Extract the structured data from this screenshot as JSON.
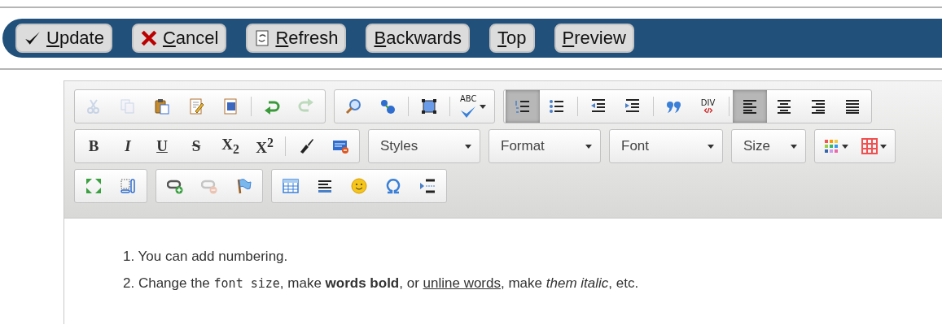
{
  "action_bar": {
    "buttons": [
      {
        "label": "Update"
      },
      {
        "label": "Cancel"
      },
      {
        "label": "Refresh"
      },
      {
        "label": "Backwards"
      },
      {
        "label": "Top"
      },
      {
        "label": "Preview"
      }
    ]
  },
  "editor": {
    "toolbar_rows": [
      {
        "items": [
          {
            "kind": "group",
            "sections": [
              [
                {
                  "disabled": true,
                  "on": false
                },
                {
                  "disabled": true,
                  "on": false
                },
                {
                  "disabled": false,
                  "on": false
                },
                {
                  "disabled": false,
                  "on": false
                },
                {
                  "disabled": false,
                  "on": false
                }
              ],
              [
                {
                  "disabled": false,
                  "on": false
                },
                {
                  "disabled": true,
                  "on": false
                }
              ]
            ]
          },
          {
            "kind": "group",
            "sections": [
              [
                {
                  "disabled": false,
                  "on": false
                },
                {
                  "disabled": false,
                  "on": false
                }
              ],
              [
                {
                  "disabled": false,
                  "on": false
                }
              ],
              [
                {
                  "disabled": false,
                  "glyph": "ABC",
                  "dropdown": true
                }
              ]
            ]
          },
          {
            "kind": "group",
            "sections": [
              [
                {
                  "disabled": false,
                  "on": true
                },
                {
                  "disabled": false,
                  "on": false
                }
              ],
              [
                {
                  "disabled": false,
                  "on": false
                },
                {
                  "disabled": false,
                  "on": false
                }
              ],
              [
                {
                  "disabled": false,
                  "on": false
                },
                {
                  "disabled": false,
                  "on": false,
                  "glyph": "DIV"
                }
              ],
              [
                {
                  "disabled": false,
                  "on": true
                },
                {
                  "disabled": false,
                  "on": false
                },
                {
                  "disabled": false,
                  "on": false
                },
                {
                  "disabled": false,
                  "on": false
                }
              ]
            ]
          }
        ]
      },
      {
        "items": [
          {
            "kind": "group",
            "sections": [
              [
                {
                  "disabled": false,
                  "on": false,
                  "glyph": "B"
                },
                {
                  "disabled": false,
                  "on": false,
                  "glyph": "I"
                },
                {
                  "disabled": false,
                  "on": false,
                  "glyph": "U"
                },
                {
                  "disabled": false,
                  "on": false,
                  "glyph": "S"
                },
                {
                  "disabled": false,
                  "on": false,
                  "glyph": "X$_{2}$"
                },
                {
                  "disabled": false,
                  "on": false,
                  "glyph": "X$^{2}$"
                }
              ],
              [
                {
                  "disabled": false,
                  "on": false
                },
                {
                  "disabled": false,
                  "on": false
                }
              ]
            ]
          },
          {
            "kind": "combo",
            "label": "Styles"
          },
          {
            "kind": "combo",
            "label": "Format"
          },
          {
            "kind": "combo",
            "label": "Font"
          },
          {
            "kind": "combo",
            "label": "Size"
          },
          {
            "kind": "group",
            "sections": [
              [
                {
                  "disabled": false,
                  "on": false,
                  "dropdown": true
                },
                {
                  "disabled": false,
                  "on": false,
                  "dropdown": true
                }
              ]
            ]
          }
        ]
      },
      {
        "items": [
          {
            "kind": "group",
            "sections": [
              [
                {
                  "disabled": false,
                  "on": false
                },
                {
                  "disabled": false,
                  "on": false
                }
              ]
            ]
          },
          {
            "kind": "group",
            "sections": [
              [
                {
                  "disabled": false,
                  "on": false
                },
                {
                  "disabled": true,
                  "on": false
                },
                {
                  "disabled": false,
                  "on": false
                }
              ]
            ]
          },
          {
            "kind": "group",
            "sections": [
              [
                {
                  "disabled": false,
                  "on": false
                },
                {
                  "disabled": false,
                  "on": false
                },
                {
                  "disabled": false,
                  "on": false
                },
                {
                  "disabled": false,
                  "on": false
                },
                {
                  "disabled": false,
                  "on": false
                }
              ]
            ]
          }
        ]
      }
    ],
    "content": {
      "numbered_list": [
        {
          "number": "1.",
          "segments": [
            {
              "kind": "plain",
              "text": "You can add numbering."
            }
          ]
        },
        {
          "number": "2.",
          "segments": [
            {
              "kind": "plain",
              "text": "Change the "
            },
            {
              "kind": "mono",
              "text": "font size"
            },
            {
              "kind": "plain",
              "text": ", make "
            },
            {
              "kind": "bold",
              "text": "words bold"
            },
            {
              "kind": "plain",
              "text": ", or "
            },
            {
              "kind": "underline",
              "text": "unline words"
            },
            {
              "kind": "plain",
              "text": ", make "
            },
            {
              "kind": "italic",
              "text": "them italic"
            },
            {
              "kind": "plain",
              "text": ", etc."
            }
          ]
        }
      ]
    }
  }
}
